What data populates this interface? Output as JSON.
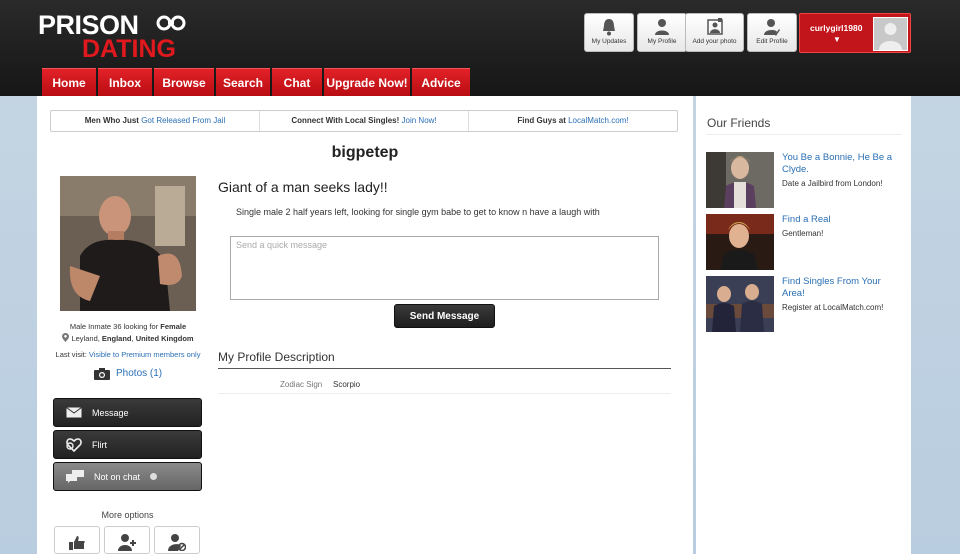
{
  "logo": {
    "line1": "PRISON",
    "line2": "DATING"
  },
  "nav": [
    "Home",
    "Inbox",
    "Browse",
    "Search",
    "Chat",
    "Upgrade Now!",
    "Advice"
  ],
  "toolbar": {
    "updates": "My Updates",
    "profile": "My Profile",
    "add_photo": "Add your photo",
    "edit_profile": "Edit Profile"
  },
  "user": {
    "name": "curlygirl1980",
    "caret": "▼"
  },
  "promo": [
    {
      "text": "Men Who Just ",
      "link": "Got Released From Jail"
    },
    {
      "text": "Connect With Local Singles! ",
      "link": "Join Now!"
    },
    {
      "text": "Find Guys at ",
      "link": "LocalMatch.com!"
    }
  ],
  "profile": {
    "username": "bigpetep",
    "bio_line1": "Male Inmate 36 looking for ",
    "bio_seeking": "Female",
    "bio_loc_a": "Leyland, ",
    "bio_loc_b": "England",
    "bio_loc_c": ", ",
    "bio_loc_d": "United Kingdom",
    "last_visit_label": "Last visit: ",
    "last_visit_value": "Visible to Premium members only",
    "photos": "Photos (1)",
    "headline": "Giant of a man seeks lady!!",
    "description": "Single male 2 half years left, looking for single gym babe to get to know n have a laugh with",
    "message_placeholder": "Send a quick message",
    "send_label": "Send Message",
    "section_title": "My Profile Description",
    "zodiac_label": "Zodiac Sign",
    "zodiac_value": "Scorpio"
  },
  "actions": {
    "message": "Message",
    "flirt": "Flirt",
    "chat": "Not on chat",
    "more": "More options"
  },
  "friends": {
    "title": "Our Friends",
    "items": [
      {
        "title": "You Be a Bonnie, He Be a Clyde.",
        "sub": "Date a Jailbird from London!"
      },
      {
        "title": "Find a Real",
        "sub": "Gentleman!"
      },
      {
        "title": "Find Singles From Your Area!",
        "sub": "Register at LocalMatch.com!"
      }
    ]
  },
  "colors": {
    "accent": "#d11a20",
    "link": "#2a6fb4",
    "header": "#1e1e1e"
  }
}
